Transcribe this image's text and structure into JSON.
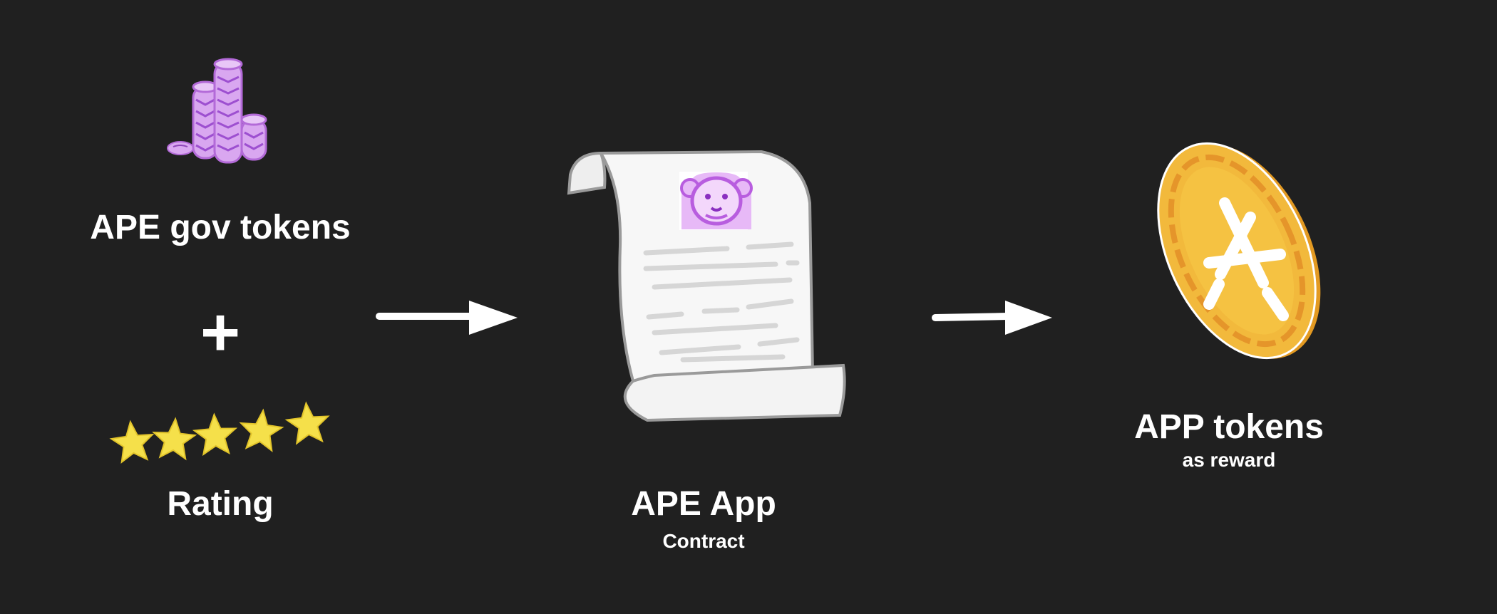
{
  "left_group": {
    "gov_tokens_label": "APE gov tokens",
    "plus_sign": "+",
    "rating_label": "Rating",
    "rating_stars": 5
  },
  "center_group": {
    "app_label": "APE App",
    "app_sublabel": "Contract"
  },
  "right_group": {
    "tokens_label": "APP tokens",
    "tokens_sublabel": "as reward"
  },
  "colors": {
    "background": "#202020",
    "text": "#ffffff",
    "coin_stack_purple": "#d9a7f0",
    "star_yellow": "#f5e04a",
    "coin_gold": "#f2b93c",
    "contract_paper": "#f7f7f7"
  },
  "icons": {
    "gov_tokens": "coin-stack-icon",
    "rating": "stars-icon",
    "contract": "scroll-icon",
    "contract_badge": "ape-face-icon",
    "reward": "gold-coin-icon",
    "flow_arrow": "arrow-right-icon"
  }
}
